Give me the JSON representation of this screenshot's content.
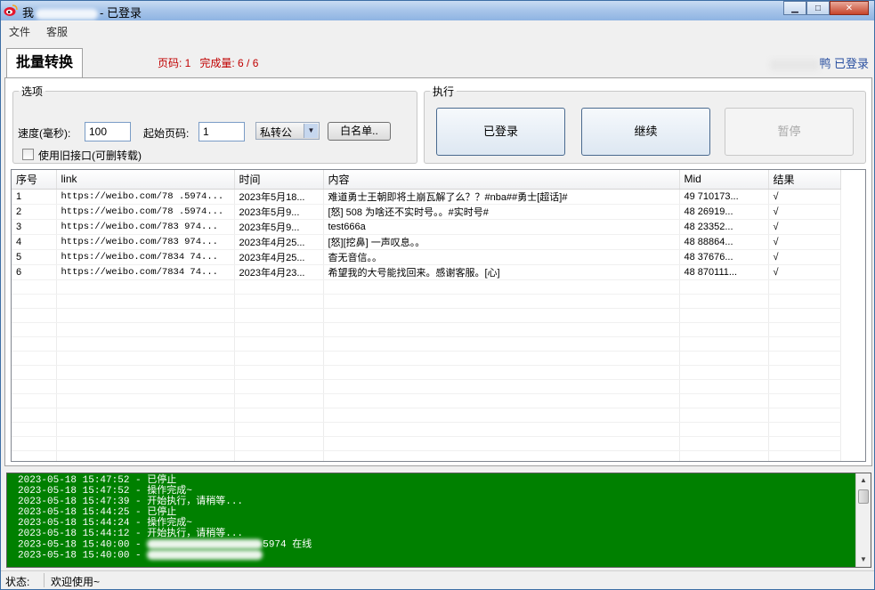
{
  "window": {
    "title_prefix": "我",
    "title_suffix": "- 已登录"
  },
  "menu": {
    "items": [
      "文件",
      "客服"
    ]
  },
  "tab": {
    "label": "批量转换"
  },
  "progress": {
    "page_text": "页码: 1",
    "done_text": "完成量: 6 / 6"
  },
  "login_status": {
    "suffix": "鸭",
    "status": "已登录"
  },
  "options": {
    "legend": "选项",
    "speed_label": "速度(毫秒):",
    "speed_value": "100",
    "start_page_label": "起始页码:",
    "start_page_value": "1",
    "mode_value": "私转公",
    "whitelist_button": "白名单..",
    "legacy_api_label": "使用旧接口(可删转载)",
    "legacy_api_checked": false
  },
  "execute": {
    "legend": "执行",
    "login_button": "已登录",
    "continue_button": "继续",
    "pause_button": "暂停"
  },
  "table": {
    "columns": [
      "序号",
      "link",
      "时间",
      "内容",
      "Mid",
      "结果"
    ],
    "rows": [
      [
        "1",
        "https://weibo.com/78  .5974...",
        "2023年5月18...",
        "难道勇士王朝即将土崩瓦解了么？？#nba##勇士[超话]#",
        "49   710173...",
        "√"
      ],
      [
        "2",
        "https://weibo.com/78  .5974...",
        "2023年5月9...",
        "[怒] 508 为啥还不实时号。。#实时号#",
        "48   26919...",
        "√"
      ],
      [
        "3",
        "https://weibo.com/783  974...",
        "2023年5月9...",
        "test666a",
        "48   23352...",
        "√"
      ],
      [
        "4",
        "https://weibo.com/783  974...",
        "2023年4月25...",
        "[怒][挖鼻] 一声叹息。。",
        "48   88864...",
        "√"
      ],
      [
        "5",
        "https://weibo.com/7834  74...",
        "2023年4月25...",
        "杳无音信。。",
        "48   37676...",
        "√"
      ],
      [
        "6",
        "https://weibo.com/7834  74...",
        "2023年4月23...",
        "希望我的大号能找回来。感谢客服。[心]",
        "48   870111...",
        "√"
      ]
    ]
  },
  "log": {
    "lines": [
      "2023-05-18 15:47:52 - 已停止",
      "2023-05-18 15:47:52 - 操作完成~",
      "2023-05-18 15:47:39 - 开始执行，请稍等...",
      "2023-05-18 15:44:25 - 已停止",
      "2023-05-18 15:44:24 - 操作完成~",
      "2023-05-18 15:44:12 - 开始执行，请稍等..."
    ],
    "line7_prefix": "2023-05-18 15:40:00 - ",
    "line7_suffix": "5974 在线",
    "line8_prefix": "2023-05-18 15:40:00 - "
  },
  "status": {
    "label": "状态:",
    "text": "欢迎使用~"
  }
}
